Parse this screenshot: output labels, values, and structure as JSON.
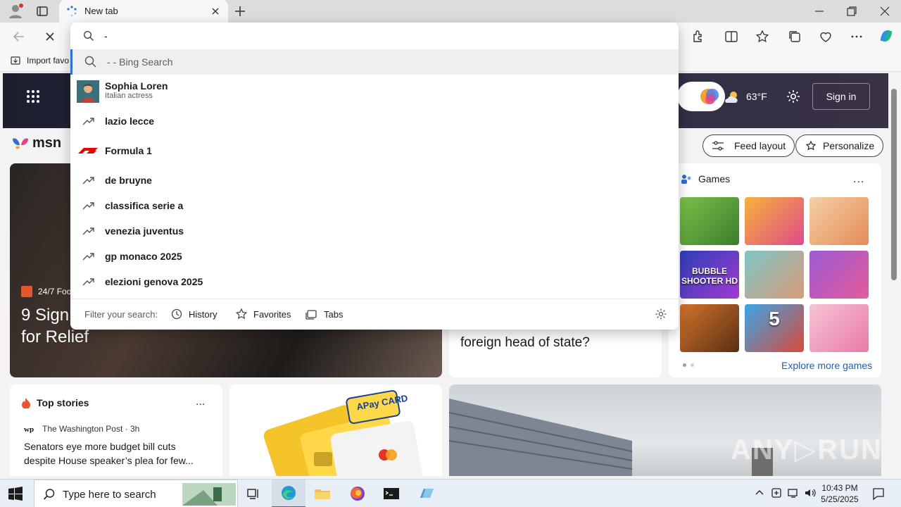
{
  "window": {
    "tab_title": "New tab"
  },
  "favorites_bar": {
    "import_label": "Import favo"
  },
  "omnibox": {
    "query": "-",
    "suggestions": [
      {
        "type": "search",
        "label": "- - Bing Search"
      },
      {
        "type": "entity",
        "label": "Sophia Loren",
        "subtitle": "Italian actress"
      },
      {
        "type": "trending",
        "label": "lazio lecce"
      },
      {
        "type": "entity-f1",
        "label": "Formula 1"
      },
      {
        "type": "trending",
        "label": "de bruyne"
      },
      {
        "type": "trending",
        "label": "classifica serie a"
      },
      {
        "type": "trending",
        "label": "venezia juventus"
      },
      {
        "type": "trending",
        "label": "gp monaco 2025"
      },
      {
        "type": "trending",
        "label": "elezioni genova 2025"
      }
    ],
    "filter_label": "Filter your search:",
    "filters": [
      "History",
      "Favorites",
      "Tabs"
    ]
  },
  "msn": {
    "logo_text": "msn",
    "weather_temp": "63°F",
    "sign_in": "Sign in",
    "feed_layout": "Feed layout",
    "personalize": "Personalize",
    "hero": {
      "source": "24/7 Foo",
      "headline": "9 Sign\nfor Relief"
    },
    "mid_card_headline": "foreign head of state?",
    "games": {
      "title": "Games",
      "more": "...",
      "explore": "Explore more games",
      "tiles": [
        {
          "colors": [
            "#7dc04a",
            "#3a7d2c"
          ],
          "label": ""
        },
        {
          "colors": [
            "#f6b33a",
            "#e04a8a"
          ],
          "label": ""
        },
        {
          "colors": [
            "#f4d0a6",
            "#e58b57"
          ],
          "label": ""
        },
        {
          "colors": [
            "#2a3fb8",
            "#a33ad1"
          ],
          "label": "BUBBLE SHOOTER HD"
        },
        {
          "colors": [
            "#7ec6c6",
            "#d99a7a"
          ],
          "label": ""
        },
        {
          "colors": [
            "#9a5bd6",
            "#e55a9a"
          ],
          "label": ""
        },
        {
          "colors": [
            "#d3732a",
            "#5a2f16"
          ],
          "label": ""
        },
        {
          "colors": [
            "#3aa6e8",
            "#d94a3a"
          ],
          "label": "5"
        },
        {
          "colors": [
            "#f7c4d6",
            "#e87aa8"
          ],
          "label": ""
        }
      ]
    },
    "top_stories": {
      "title": "Top stories",
      "more": "...",
      "source": "The Washington Post · 3h",
      "headline": "Senators eye more budget bill cuts despite House speaker’s plea for few..."
    },
    "ad": {
      "brand": "APay CARD"
    }
  },
  "taskbar": {
    "search_placeholder": "Type here to search",
    "time": "10:43 PM",
    "date": "5/25/2025"
  }
}
